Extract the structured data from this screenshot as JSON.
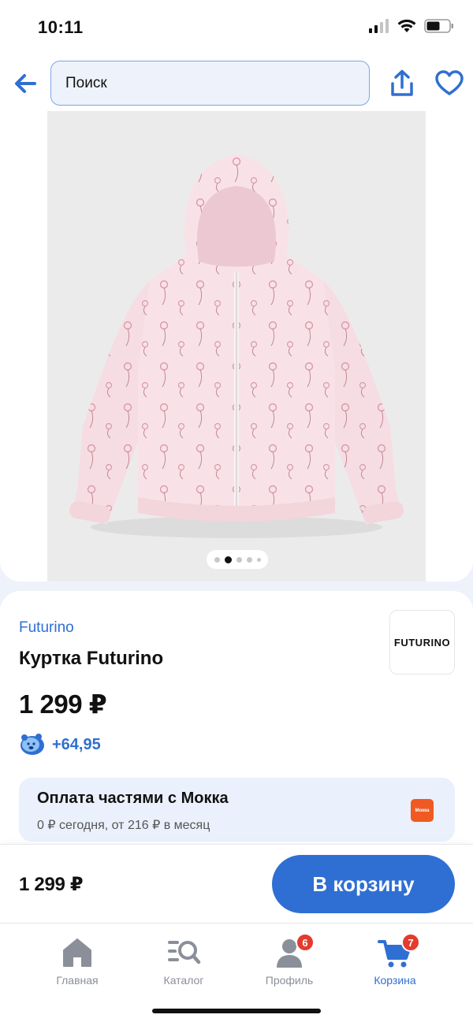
{
  "status_bar": {
    "time": "10:11"
  },
  "header": {
    "search_placeholder": "Поиск"
  },
  "gallery": {
    "image_count": 5,
    "active_index": 1
  },
  "product": {
    "brand": "Futurino",
    "brand_logo_text": "FUTURINO",
    "title": "Куртка Futurino",
    "price": "1 299 ₽",
    "bonus": "+64,95"
  },
  "installments": {
    "title": "Оплата частями с Мокка",
    "subtitle": "0 ₽ сегодня, от 216 ₽ в месяц",
    "logo_text": "Мокка"
  },
  "buy_bar": {
    "price": "1 299 ₽",
    "button_label": "В корзину"
  },
  "tab_bar": {
    "items": [
      {
        "label": "Главная",
        "icon": "home-icon"
      },
      {
        "label": "Каталог",
        "icon": "catalog-search-icon"
      },
      {
        "label": "Профиль",
        "icon": "profile-icon",
        "badge": "6"
      },
      {
        "label": "Корзина",
        "icon": "cart-icon",
        "badge": "7",
        "active": true
      }
    ]
  },
  "colors": {
    "accent": "#2f6fd3",
    "badge": "#e33b2e",
    "mokka": "#f05a22"
  }
}
